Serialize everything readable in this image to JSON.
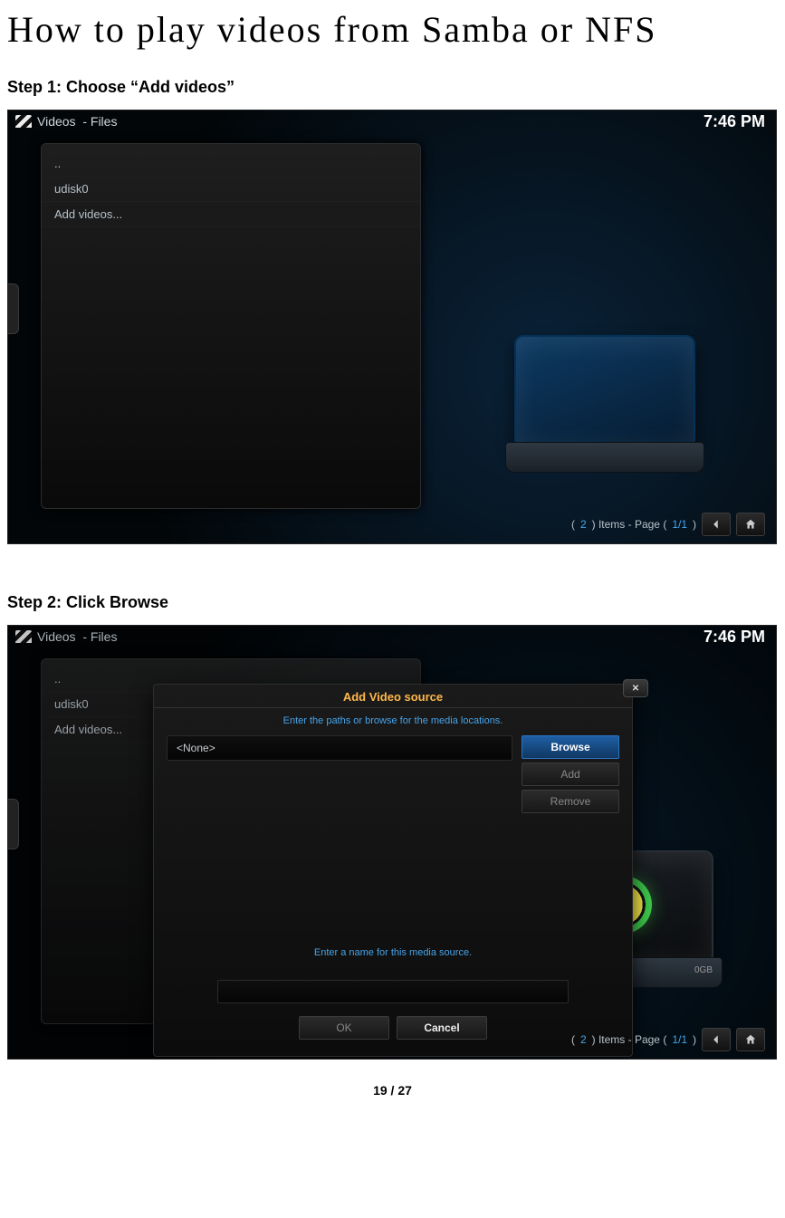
{
  "title": "How to play videos from Samba or NFS",
  "steps": {
    "s1": "Step 1: Choose “Add videos”",
    "s2": "Step 2: Click Browse"
  },
  "shot": {
    "breadcrumb_section": "Videos",
    "breadcrumb_sub": "- Files",
    "clock": "7:46 PM",
    "list": [
      "..",
      "udisk0",
      "Add videos..."
    ],
    "pager_count": "2",
    "pager_text": ") Items - Page (",
    "pager_frac": "1/1"
  },
  "dialog": {
    "title": "Add Video source",
    "hint_paths": "Enter the paths or browse for the media locations.",
    "source_value": "<None>",
    "browse": "Browse",
    "add": "Add",
    "remove": "Remove",
    "hint_name": "Enter a name for this media source.",
    "ok": "OK",
    "cancel": "Cancel",
    "close": "✕"
  },
  "pageno": "19 / 27"
}
